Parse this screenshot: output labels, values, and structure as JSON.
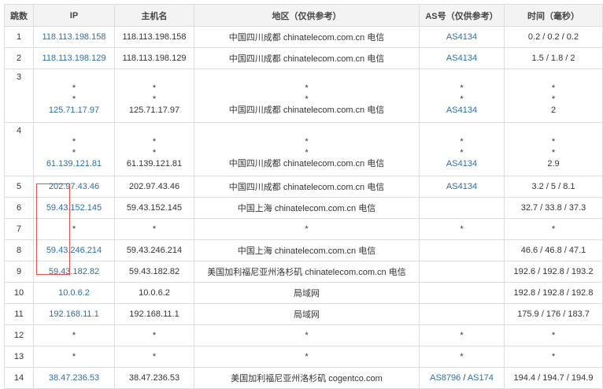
{
  "headers": {
    "hop": "跳数",
    "ip": "IP",
    "host": "主机名",
    "region": "地区（仅供参考）",
    "as": "AS号（仅供参考）",
    "time": "时间（毫秒）"
  },
  "rows": [
    {
      "hop": "1",
      "ip": "118.113.198.158",
      "host": "118.113.198.158",
      "region": "中国四川成都 chinatelecom.com.cn 电信",
      "as": "AS4134",
      "time": "0.2 / 0.2 / 0.2"
    },
    {
      "hop": "2",
      "ip": "118.113.198.129",
      "host": "118.113.198.129",
      "region": "中国四川成都 chinatelecom.com.cn 电信",
      "as": "AS4134",
      "time": "1.5 / 1.8 / 2"
    },
    {
      "hop": "3",
      "ip": "125.71.17.97",
      "host": "125.71.17.97",
      "region": "中国四川成都 chinatelecom.com.cn 电信",
      "as": "AS4134",
      "time": "2",
      "star": "*"
    },
    {
      "hop": "4",
      "ip": "61.139.121.81",
      "host": "61.139.121.81",
      "region": "中国四川成都 chinatelecom.com.cn 电信",
      "as": "AS4134",
      "time": "2.9",
      "star": "*"
    },
    {
      "hop": "5",
      "ip": "202.97.43.46",
      "host": "202.97.43.46",
      "region": "中国四川成都 chinatelecom.com.cn 电信",
      "as": "AS4134",
      "time": "3.2 / 5 / 8.1"
    },
    {
      "hop": "6",
      "ip": "59.43.152.145",
      "host": "59.43.152.145",
      "region": "中国上海 chinatelecom.com.cn 电信",
      "as": "",
      "time": "32.7 / 33.8 / 37.3"
    },
    {
      "hop": "7",
      "ip": "*",
      "host": "*",
      "region": "*",
      "as": "*",
      "time": "*"
    },
    {
      "hop": "8",
      "ip": "59.43.246.214",
      "host": "59.43.246.214",
      "region": "中国上海 chinatelecom.com.cn 电信",
      "as": "",
      "time": "46.6 / 46.8 / 47.1"
    },
    {
      "hop": "9",
      "ip": "59.43.182.82",
      "host": "59.43.182.82",
      "region": "美国加利福尼亚州洛杉矶 chinatelecom.com.cn 电信",
      "as": "",
      "time": "192.6 / 192.8 / 193.2"
    },
    {
      "hop": "10",
      "ip": "10.0.6.2",
      "host": "10.0.6.2",
      "region": "局域网",
      "as": "",
      "time": "192.8 / 192.8 / 192.8"
    },
    {
      "hop": "11",
      "ip": "192.168.11.1",
      "host": "192.168.11.1",
      "region": "局域网",
      "as": "",
      "time": "175.9 / 176 / 183.7"
    },
    {
      "hop": "12",
      "ip": "*",
      "host": "*",
      "region": "*",
      "as": "*",
      "time": "*"
    },
    {
      "hop": "13",
      "ip": "*",
      "host": "*",
      "region": "*",
      "as": "*",
      "time": "*"
    },
    {
      "hop": "14",
      "ip": "38.47.236.53",
      "host": "38.47.236.53",
      "region": "美国加利福尼亚州洛杉矶 cogentco.com",
      "as": "AS8796",
      "as_sep": " / ",
      "as2": "AS174",
      "time": "194.4 / 194.7 / 194.9"
    }
  ],
  "colors": {
    "link": "#2e6da4",
    "border": "#dddddd",
    "header_bg": "#f3f3f3",
    "highlight": "#e34d4d"
  }
}
